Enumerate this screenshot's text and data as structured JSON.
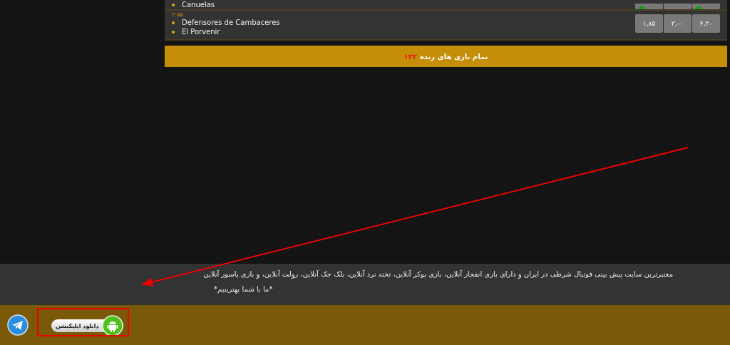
{
  "matches": [
    {
      "teams": [
        "Canuelas"
      ],
      "odds": [
        {
          "up": true
        },
        {
          "up": false
        },
        {
          "up": true
        }
      ]
    },
    {
      "time": "۲:۵۵",
      "teams": [
        "Defensores de Cambaceres",
        "El Porvenir"
      ],
      "odds": [
        {
          "value": "۴,۳۰",
          "up": false
        },
        {
          "value": "۳,۰۰",
          "up": false
        },
        {
          "value": "۱,۸۵",
          "up": false
        }
      ]
    }
  ],
  "live_bar": {
    "label": "تمام بازی های زنده",
    "count": "۱۳۲"
  },
  "footer": {
    "description": "معتبرترین سایت پیش بینی فوتبال شرطی در ایران و دارای بازی انفجار آنلاین، بازی پوکر آنلاین، تخته نرد آنلاین، بلک جک آنلاین، رولت آنلاین، و بازی پاسور آنلاین",
    "slogan": "*ما با شما بهترینیم*"
  },
  "app_button": {
    "label": "دانلود اپلیکیشن"
  }
}
